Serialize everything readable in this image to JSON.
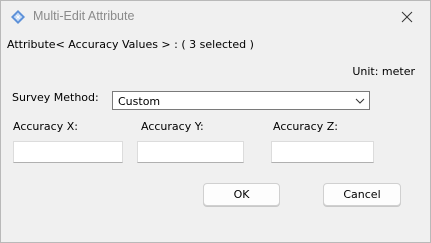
{
  "window": {
    "title": "Multi-Edit Attribute",
    "icon": "app-diamond-icon",
    "close_icon": "close-icon"
  },
  "attribute_line": "Attribute< Accuracy Values > : ( 3 selected )",
  "unit_label": "Unit: meter",
  "survey_method": {
    "label": "Survey Method:",
    "selected": "Custom"
  },
  "accuracy": {
    "x_label": "Accuracy X:",
    "y_label": "Accuracy Y:",
    "z_label": "Accuracy Z:",
    "x_value": "",
    "y_value": "",
    "z_value": ""
  },
  "buttons": {
    "ok": "OK",
    "cancel": "Cancel"
  },
  "colors": {
    "window_bg": "#f0f0f0",
    "title_text": "#8a8a8a",
    "icon_blue": "#3a7bd5"
  }
}
